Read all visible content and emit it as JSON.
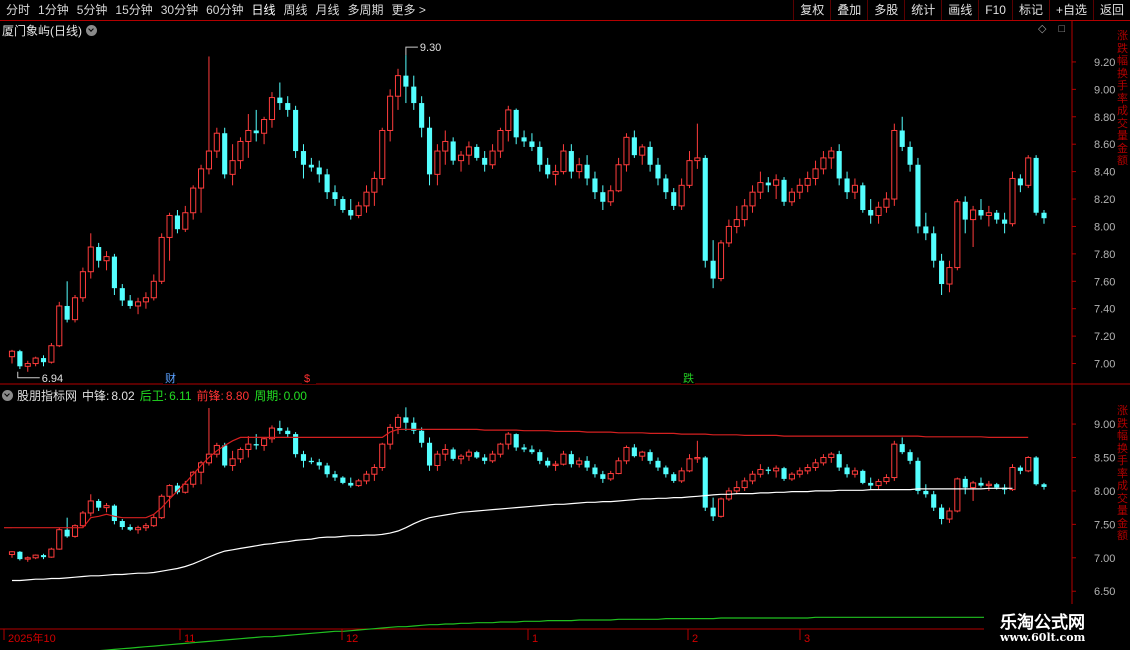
{
  "toolbar": {
    "periods": [
      "分时",
      "1分钟",
      "5分钟",
      "15分钟",
      "30分钟",
      "60分钟",
      "日线",
      "周线",
      "月线",
      "多周期",
      "更多 >"
    ],
    "buttons": [
      "复权",
      "叠加",
      "多股",
      "统计",
      "画线",
      "F10",
      "标记",
      "+自选",
      "返回"
    ]
  },
  "stock": {
    "title": "厦门象屿(日线)"
  },
  "price_axis": [
    "9.20",
    "9.00",
    "8.80",
    "8.60",
    "8.40",
    "8.20",
    "8.00",
    "7.80",
    "7.60",
    "7.40",
    "7.20",
    "7.00"
  ],
  "indicator_axis": [
    "9.00",
    "8.50",
    "8.00",
    "7.50",
    "7.00",
    "6.50"
  ],
  "high_marker": "9.30",
  "low_marker": "6.94",
  "event_markers": [
    {
      "label": "财",
      "color": "#5aa0ff"
    },
    {
      "label": "$",
      "color": "#ff3030"
    },
    {
      "label": "跌",
      "color": "#22cc22"
    }
  ],
  "indicator": {
    "name": "股朋指标网",
    "items": [
      {
        "label": "中锋:",
        "value": "8.02",
        "color": "#e0e0e0"
      },
      {
        "label": "后卫:",
        "value": "6.11",
        "color": "#22dd22"
      },
      {
        "label": "前锋:",
        "value": "8.80",
        "color": "#ff3333"
      },
      {
        "label": "周期:",
        "value": "0.00",
        "color": "#22dd22"
      }
    ]
  },
  "date_axis": [
    "2025年10",
    "11",
    "12",
    "1",
    "2",
    "3"
  ],
  "right_side_text": "涨跌幅换手率成交量金额",
  "watermark": {
    "line1": "乐淘公式网",
    "line2": "www.60lt.com"
  },
  "colors": {
    "up": "#ff3c3c",
    "down": "#54ffff",
    "grid": "#b30000",
    "ma": "#ffffff",
    "upper": "#d42020",
    "lower": "#20c020"
  },
  "chart_data": {
    "type": "candlestick",
    "ylim": [
      6.88,
      9.36
    ],
    "candles": [
      [
        7.05,
        7.1,
        7.0,
        7.09
      ],
      [
        7.09,
        7.1,
        6.96,
        6.98
      ],
      [
        6.98,
        7.02,
        6.94,
        7.0
      ],
      [
        7.0,
        7.05,
        6.98,
        7.04
      ],
      [
        7.04,
        7.06,
        6.98,
        7.01
      ],
      [
        7.01,
        7.15,
        7.0,
        7.13
      ],
      [
        7.13,
        7.45,
        7.12,
        7.42
      ],
      [
        7.42,
        7.6,
        7.3,
        7.32
      ],
      [
        7.32,
        7.5,
        7.3,
        7.48
      ],
      [
        7.48,
        7.7,
        7.45,
        7.67
      ],
      [
        7.67,
        7.95,
        7.62,
        7.85
      ],
      [
        7.85,
        7.88,
        7.7,
        7.75
      ],
      [
        7.75,
        7.82,
        7.68,
        7.78
      ],
      [
        7.78,
        7.8,
        7.5,
        7.55
      ],
      [
        7.55,
        7.58,
        7.42,
        7.46
      ],
      [
        7.46,
        7.5,
        7.4,
        7.42
      ],
      [
        7.42,
        7.48,
        7.36,
        7.45
      ],
      [
        7.45,
        7.52,
        7.4,
        7.48
      ],
      [
        7.48,
        7.65,
        7.46,
        7.6
      ],
      [
        7.6,
        7.95,
        7.58,
        7.92
      ],
      [
        7.92,
        8.1,
        7.75,
        8.08
      ],
      [
        8.08,
        8.12,
        7.95,
        7.98
      ],
      [
        7.98,
        8.15,
        7.96,
        8.1
      ],
      [
        8.1,
        8.3,
        8.05,
        8.28
      ],
      [
        8.28,
        8.45,
        8.1,
        8.42
      ],
      [
        8.42,
        9.24,
        8.38,
        8.55
      ],
      [
        8.55,
        8.72,
        8.5,
        8.68
      ],
      [
        8.68,
        8.72,
        8.35,
        8.38
      ],
      [
        8.38,
        8.6,
        8.3,
        8.48
      ],
      [
        8.48,
        8.65,
        8.42,
        8.62
      ],
      [
        8.62,
        8.82,
        8.5,
        8.7
      ],
      [
        8.7,
        8.85,
        8.62,
        8.68
      ],
      [
        8.68,
        8.8,
        8.6,
        8.78
      ],
      [
        8.78,
        8.98,
        8.72,
        8.94
      ],
      [
        8.94,
        9.05,
        8.85,
        8.9
      ],
      [
        8.9,
        8.95,
        8.8,
        8.85
      ],
      [
        8.85,
        8.88,
        8.5,
        8.55
      ],
      [
        8.55,
        8.6,
        8.35,
        8.45
      ],
      [
        8.45,
        8.5,
        8.4,
        8.43
      ],
      [
        8.43,
        8.48,
        8.32,
        8.38
      ],
      [
        8.38,
        8.42,
        8.2,
        8.25
      ],
      [
        8.25,
        8.3,
        8.15,
        8.2
      ],
      [
        8.2,
        8.22,
        8.1,
        8.12
      ],
      [
        8.12,
        8.2,
        8.05,
        8.08
      ],
      [
        8.08,
        8.18,
        8.06,
        8.15
      ],
      [
        8.15,
        8.3,
        8.1,
        8.25
      ],
      [
        8.25,
        8.4,
        8.15,
        8.35
      ],
      [
        8.35,
        8.72,
        8.3,
        8.7
      ],
      [
        8.7,
        9.0,
        8.62,
        8.95
      ],
      [
        8.95,
        9.15,
        8.85,
        9.1
      ],
      [
        9.1,
        9.25,
        8.9,
        9.02
      ],
      [
        9.02,
        9.1,
        8.85,
        8.9
      ],
      [
        8.9,
        8.95,
        8.65,
        8.72
      ],
      [
        8.72,
        8.8,
        8.3,
        8.38
      ],
      [
        8.38,
        8.6,
        8.3,
        8.55
      ],
      [
        8.55,
        8.7,
        8.45,
        8.62
      ],
      [
        8.62,
        8.65,
        8.45,
        8.48
      ],
      [
        8.48,
        8.55,
        8.4,
        8.52
      ],
      [
        8.52,
        8.62,
        8.45,
        8.58
      ],
      [
        8.58,
        8.6,
        8.48,
        8.5
      ],
      [
        8.5,
        8.55,
        8.4,
        8.45
      ],
      [
        8.45,
        8.6,
        8.42,
        8.55
      ],
      [
        8.55,
        8.72,
        8.5,
        8.7
      ],
      [
        8.7,
        8.88,
        8.62,
        8.85
      ],
      [
        8.85,
        8.86,
        8.6,
        8.65
      ],
      [
        8.65,
        8.7,
        8.58,
        8.62
      ],
      [
        8.62,
        8.68,
        8.55,
        8.58
      ],
      [
        8.58,
        8.62,
        8.4,
        8.45
      ],
      [
        8.45,
        8.5,
        8.35,
        8.38
      ],
      [
        8.38,
        8.45,
        8.3,
        8.4
      ],
      [
        8.4,
        8.6,
        8.38,
        8.55
      ],
      [
        8.55,
        8.6,
        8.35,
        8.4
      ],
      [
        8.4,
        8.5,
        8.35,
        8.45
      ],
      [
        8.45,
        8.52,
        8.3,
        8.35
      ],
      [
        8.35,
        8.4,
        8.2,
        8.25
      ],
      [
        8.25,
        8.3,
        8.12,
        8.18
      ],
      [
        8.18,
        8.3,
        8.15,
        8.26
      ],
      [
        8.26,
        8.5,
        8.25,
        8.45
      ],
      [
        8.45,
        8.68,
        8.4,
        8.65
      ],
      [
        8.65,
        8.7,
        8.5,
        8.52
      ],
      [
        8.52,
        8.6,
        8.45,
        8.58
      ],
      [
        8.58,
        8.62,
        8.4,
        8.45
      ],
      [
        8.45,
        8.5,
        8.3,
        8.35
      ],
      [
        8.35,
        8.38,
        8.2,
        8.25
      ],
      [
        8.25,
        8.28,
        8.12,
        8.15
      ],
      [
        8.15,
        8.35,
        8.12,
        8.3
      ],
      [
        8.3,
        8.55,
        8.28,
        8.48
      ],
      [
        8.48,
        8.75,
        8.42,
        8.5
      ],
      [
        8.5,
        8.52,
        7.7,
        7.75
      ],
      [
        7.75,
        7.9,
        7.55,
        7.62
      ],
      [
        7.62,
        7.9,
        7.6,
        7.88
      ],
      [
        7.88,
        8.05,
        7.85,
        8.0
      ],
      [
        8.0,
        8.15,
        7.95,
        8.05
      ],
      [
        8.05,
        8.2,
        8.0,
        8.15
      ],
      [
        8.15,
        8.3,
        8.1,
        8.25
      ],
      [
        8.25,
        8.4,
        8.2,
        8.32
      ],
      [
        8.32,
        8.36,
        8.25,
        8.3
      ],
      [
        8.3,
        8.38,
        8.2,
        8.34
      ],
      [
        8.34,
        8.36,
        8.15,
        8.18
      ],
      [
        8.18,
        8.28,
        8.15,
        8.25
      ],
      [
        8.25,
        8.35,
        8.2,
        8.3
      ],
      [
        8.3,
        8.4,
        8.25,
        8.35
      ],
      [
        8.35,
        8.48,
        8.3,
        8.42
      ],
      [
        8.42,
        8.55,
        8.38,
        8.5
      ],
      [
        8.5,
        8.58,
        8.42,
        8.55
      ],
      [
        8.55,
        8.6,
        8.3,
        8.35
      ],
      [
        8.35,
        8.4,
        8.2,
        8.25
      ],
      [
        8.25,
        8.35,
        8.2,
        8.3
      ],
      [
        8.3,
        8.32,
        8.1,
        8.12
      ],
      [
        8.12,
        8.2,
        8.02,
        8.08
      ],
      [
        8.08,
        8.18,
        8.02,
        8.14
      ],
      [
        8.14,
        8.25,
        8.1,
        8.2
      ],
      [
        8.2,
        8.75,
        8.15,
        8.7
      ],
      [
        8.7,
        8.8,
        8.55,
        8.58
      ],
      [
        8.58,
        8.62,
        8.4,
        8.45
      ],
      [
        8.45,
        8.5,
        7.95,
        8.0
      ],
      [
        8.0,
        8.1,
        7.9,
        7.95
      ],
      [
        7.95,
        8.0,
        7.7,
        7.75
      ],
      [
        7.75,
        7.8,
        7.5,
        7.58
      ],
      [
        7.58,
        7.75,
        7.52,
        7.7
      ],
      [
        7.7,
        8.2,
        7.68,
        8.18
      ],
      [
        8.18,
        8.22,
        7.95,
        8.05
      ],
      [
        8.05,
        8.15,
        7.85,
        8.12
      ],
      [
        8.12,
        8.2,
        8.05,
        8.08
      ],
      [
        8.08,
        8.15,
        8.0,
        8.1
      ],
      [
        8.1,
        8.12,
        8.02,
        8.05
      ],
      [
        8.05,
        8.1,
        7.95,
        8.02
      ],
      [
        8.02,
        8.4,
        8.0,
        8.35
      ],
      [
        8.35,
        8.38,
        8.25,
        8.3
      ],
      [
        8.3,
        8.52,
        8.28,
        8.5
      ],
      [
        8.5,
        8.52,
        8.08,
        8.1
      ],
      [
        8.1,
        8.12,
        8.02,
        8.06
      ]
    ],
    "ma": [
      6.66,
      6.66,
      6.67,
      6.68,
      6.68,
      6.69,
      6.69,
      6.7,
      6.71,
      6.72,
      6.73,
      6.73,
      6.74,
      6.75,
      6.75,
      6.76,
      6.77,
      6.77,
      6.78,
      6.8,
      6.82,
      6.84,
      6.87,
      6.91,
      6.96,
      7.01,
      7.06,
      7.1,
      7.12,
      7.14,
      7.16,
      7.18,
      7.2,
      7.21,
      7.23,
      7.24,
      7.26,
      7.27,
      7.28,
      7.3,
      7.31,
      7.31,
      7.32,
      7.33,
      7.33,
      7.34,
      7.34,
      7.35,
      7.37,
      7.4,
      7.45,
      7.51,
      7.56,
      7.6,
      7.62,
      7.64,
      7.66,
      7.68,
      7.69,
      7.7,
      7.71,
      7.72,
      7.73,
      7.74,
      7.75,
      7.76,
      7.77,
      7.78,
      7.79,
      7.8,
      7.8,
      7.81,
      7.82,
      7.83,
      7.83,
      7.84,
      7.84,
      7.85,
      7.86,
      7.87,
      7.88,
      7.88,
      7.89,
      7.89,
      7.9,
      7.9,
      7.91,
      7.92,
      7.93,
      7.94,
      7.95,
      7.95,
      7.96,
      7.96,
      7.96,
      7.97,
      7.97,
      7.98,
      7.98,
      7.99,
      7.99,
      7.99,
      8.0,
      8.0,
      8.0,
      8.01,
      8.01,
      8.01,
      8.01,
      8.02,
      8.02,
      8.02,
      8.02,
      8.02,
      8.02,
      8.03,
      8.03,
      8.03,
      8.03,
      8.03,
      8.03,
      8.03,
      8.03,
      8.03,
      8.04,
      8.04,
      8.04,
      8.04
    ],
    "upper": [
      7.45,
      7.45,
      7.45,
      7.45,
      7.45,
      7.45,
      7.45,
      7.45,
      7.45,
      7.45,
      7.6,
      7.62,
      7.65,
      7.62,
      7.6,
      7.6,
      7.6,
      7.6,
      7.65,
      7.75,
      7.88,
      8.0,
      8.12,
      8.25,
      8.38,
      8.5,
      8.6,
      8.68,
      8.75,
      8.8,
      8.8,
      8.8,
      8.8,
      8.8,
      8.8,
      8.8,
      8.8,
      8.8,
      8.8,
      8.8,
      8.8,
      8.8,
      8.8,
      8.8,
      8.8,
      8.8,
      8.8,
      8.8,
      8.88,
      8.92,
      8.92,
      8.92,
      8.92,
      8.92,
      8.92,
      8.92,
      8.92,
      8.92,
      8.92,
      8.92,
      8.91,
      8.91,
      8.91,
      8.91,
      8.91,
      8.9,
      8.9,
      8.9,
      8.9,
      8.89,
      8.89,
      8.89,
      8.89,
      8.88,
      8.88,
      8.88,
      8.88,
      8.87,
      8.87,
      8.87,
      8.87,
      8.86,
      8.86,
      8.86,
      8.86,
      8.85,
      8.85,
      8.85,
      8.85,
      8.84,
      8.84,
      8.84,
      8.84,
      8.83,
      8.83,
      8.83,
      8.83,
      8.83,
      8.82,
      8.82,
      8.82,
      8.82,
      8.82,
      8.82,
      8.82,
      8.82,
      8.82,
      8.82,
      8.82,
      8.82,
      8.82,
      8.82,
      8.82,
      8.82,
      8.82,
      8.82,
      8.81,
      8.81,
      8.81,
      8.81,
      8.81,
      8.81,
      8.81,
      8.81,
      8.8,
      8.8,
      8.8,
      8.8,
      8.8,
      8.8
    ],
    "lower": [
      5.5,
      5.51,
      5.52,
      5.53,
      5.54,
      5.55,
      5.56,
      5.57,
      5.58,
      5.59,
      5.6,
      5.61,
      5.62,
      5.63,
      5.64,
      5.65,
      5.66,
      5.67,
      5.68,
      5.69,
      5.7,
      5.71,
      5.72,
      5.73,
      5.74,
      5.75,
      5.76,
      5.77,
      5.78,
      5.79,
      5.8,
      5.81,
      5.82,
      5.82,
      5.83,
      5.84,
      5.85,
      5.86,
      5.87,
      5.88,
      5.89,
      5.9,
      5.9,
      5.91,
      5.92,
      5.93,
      5.94,
      5.95,
      5.96,
      5.97,
      5.97,
      5.98,
      5.99,
      6.0,
      6.0,
      6.01,
      6.01,
      6.02,
      6.02,
      6.03,
      6.03,
      6.03,
      6.04,
      6.04,
      6.04,
      6.05,
      6.05,
      6.05,
      6.06,
      6.06,
      6.06,
      6.06,
      6.07,
      6.07,
      6.07,
      6.07,
      6.07,
      6.08,
      6.08,
      6.08,
      6.08,
      6.08,
      6.08,
      6.09,
      6.09,
      6.09,
      6.09,
      6.09,
      6.09,
      6.09,
      6.1,
      6.1,
      6.1,
      6.1,
      6.1,
      6.1,
      6.1,
      6.1,
      6.1,
      6.1,
      6.1,
      6.1,
      6.11,
      6.11,
      6.11,
      6.11,
      6.11,
      6.11,
      6.11,
      6.11,
      6.11,
      6.11,
      6.11,
      6.11,
      6.11,
      6.11,
      6.11,
      6.11,
      6.11,
      6.11,
      6.11,
      6.11,
      6.11,
      6.11,
      6.11,
      6.11,
      6.11,
      6.11,
      6.11,
      6.11,
      6.11,
      6.11
    ]
  }
}
